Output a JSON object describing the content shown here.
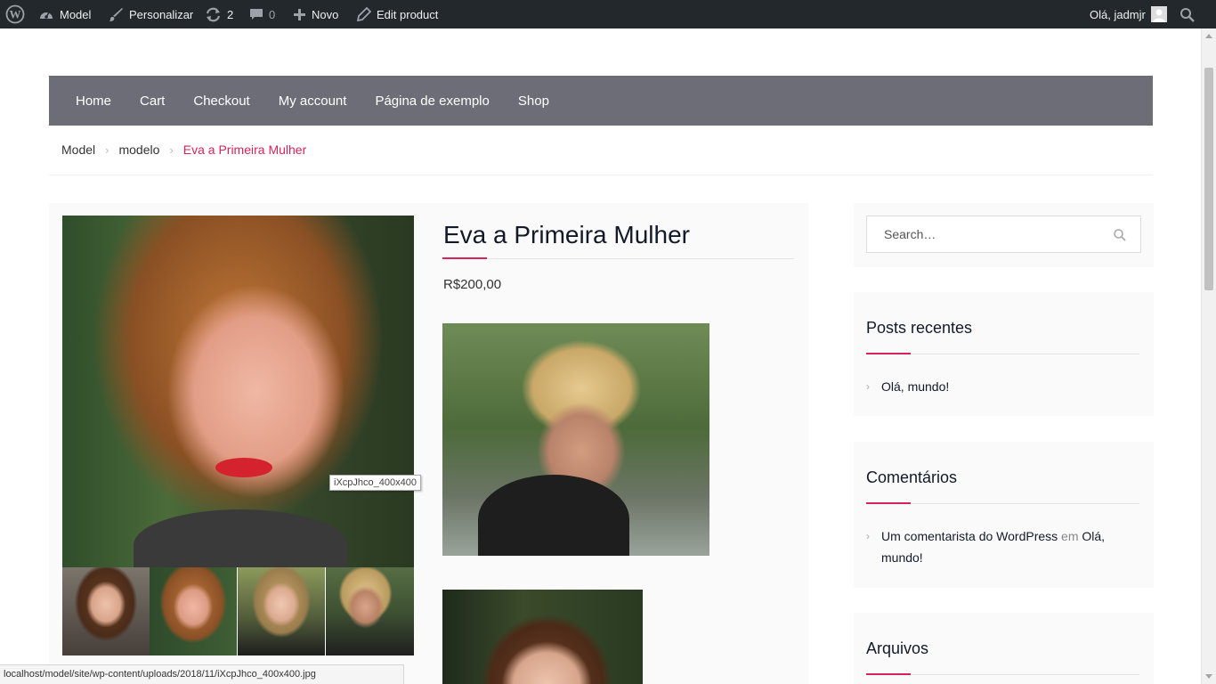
{
  "admin_bar": {
    "wp_logo_icon": "wordpress-icon",
    "site_name": "Model",
    "customize": "Personalizar",
    "updates_count": "2",
    "comments_count": "0",
    "new": "Novo",
    "edit_product": "Edit product",
    "greeting": "Olá, jadmjr"
  },
  "nav": {
    "items": [
      "Home",
      "Cart",
      "Checkout",
      "My account",
      "Página de exemplo",
      "Shop"
    ]
  },
  "breadcrumb": {
    "items": [
      "Model",
      "modelo"
    ],
    "current": "Eva a Primeira Mulher"
  },
  "product": {
    "title": "Eva a Primeira Mulher",
    "price": "R$200,00",
    "image_tooltip": "iXcpJhco_400x400"
  },
  "sidebar": {
    "search_placeholder": "Search…",
    "recent_posts": {
      "title": "Posts recentes",
      "items": [
        "Olá, mundo!"
      ]
    },
    "comments": {
      "title": "Comentários",
      "author": "Um comentarista do WordPress",
      "connector": "em",
      "post_part1": "Olá,",
      "post_part2": "mundo!"
    },
    "archives": {
      "title": "Arquivos"
    }
  },
  "status_bar": {
    "url": "localhost/model/site/wp-content/uploads/2018/11/iXcpJhco_400x400.jpg"
  },
  "colors": {
    "admin_bar": "#23282d",
    "nav_bg": "#6d6d77",
    "accent": "#d6245a",
    "heading": "#121a2a"
  }
}
